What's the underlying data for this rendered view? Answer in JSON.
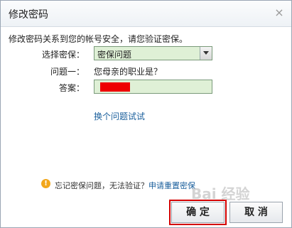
{
  "dialog": {
    "title": "修改密码",
    "close_glyph": "×",
    "intro": "修改密码关系到您的帐号安全，请您验证密保。",
    "security_label": "选择密保：",
    "security_selected": "密保问题",
    "question_label": "问题一：",
    "question_text": "您母亲的职业是？",
    "answer_label": "答案：",
    "change_link": "换个问题试试",
    "footer_warn_glyph": "!",
    "footer_text": "忘记密保问题，无法验证？",
    "footer_link": "申请重置密保",
    "watermark": "Bai 经验",
    "ok_label": "确 定",
    "cancel_label": "取 消"
  },
  "colors": {
    "field_bg": "#dff0d6",
    "link": "#1a5f9c",
    "highlight": "#d40000",
    "redaction": "#ee0000"
  }
}
